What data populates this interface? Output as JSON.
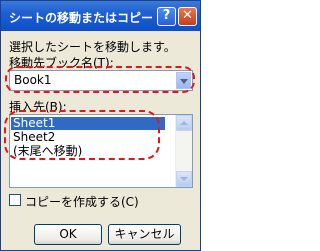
{
  "dialog": {
    "title": "シートの移動またはコピー",
    "help_glyph": "?",
    "close_glyph": "✕",
    "instruction": "選択したシートを移動します。",
    "dest_book_label": "移動先ブック名(T):",
    "dest_book_value": "Book1",
    "insert_before_label": "挿入先(B):",
    "sheets": [
      "Sheet1",
      "Sheet2",
      "(末尾へ移動)"
    ],
    "selected_sheet": "Sheet1",
    "copy_checkbox_label": "コピーを作成する(C)",
    "copy_checked": false,
    "ok_label": "OK",
    "cancel_label": "キャンセル"
  },
  "colors": {
    "title_bar": "#0b4fc9",
    "selection": "#316ac5",
    "annotation": "#e8141c"
  }
}
